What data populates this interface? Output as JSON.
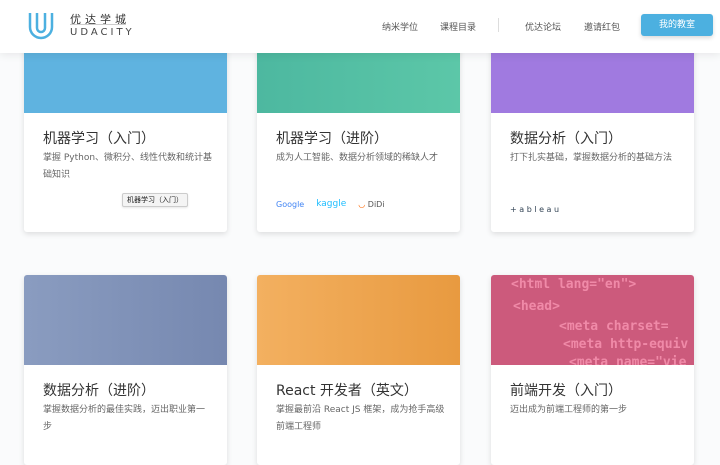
{
  "header": {
    "logo_cn": "优达学城",
    "logo_en": "UDACITY",
    "nav": [
      "纳米学位",
      "课程目录",
      "优达论坛",
      "邀请红包"
    ],
    "cta": "我的教室"
  },
  "cards": [
    {
      "title": "机器学习（入门）",
      "desc": "掌握 Python、微积分、线性代数和统计基础知识",
      "badge": "机器学习（入门）",
      "color": "#5fb3e0"
    },
    {
      "title": "机器学习（进阶）",
      "desc": "成为人工智能、数据分析领域的稀缺人才",
      "partners": [
        "Google",
        "kaggle",
        "DiDi"
      ],
      "color": "#4dbfa5"
    },
    {
      "title": "数据分析（入门）",
      "desc": "打下扎实基础，掌握数据分析的基础方法",
      "partners": [
        "+ a b l e a u"
      ],
      "color": "#a07ae0"
    },
    {
      "title": "数据分析（进阶）",
      "desc": "掌握数据分析的最佳实践，迈出职业第一步",
      "color": "#7f93b8"
    },
    {
      "title": "React 开发者（英文）",
      "desc": "掌握最前沿 React JS 框架，成为抢手高级前端工程师",
      "color": "#f0a650"
    },
    {
      "title": "前端开发（入门）",
      "desc": "迈出成为前端工程师的第一步",
      "color": "#d05a7c",
      "code": [
        "<html lang=\"en\">",
        "<head>",
        "<meta charset=",
        "<meta http-equiv",
        "<meta name=\"vie"
      ]
    }
  ]
}
